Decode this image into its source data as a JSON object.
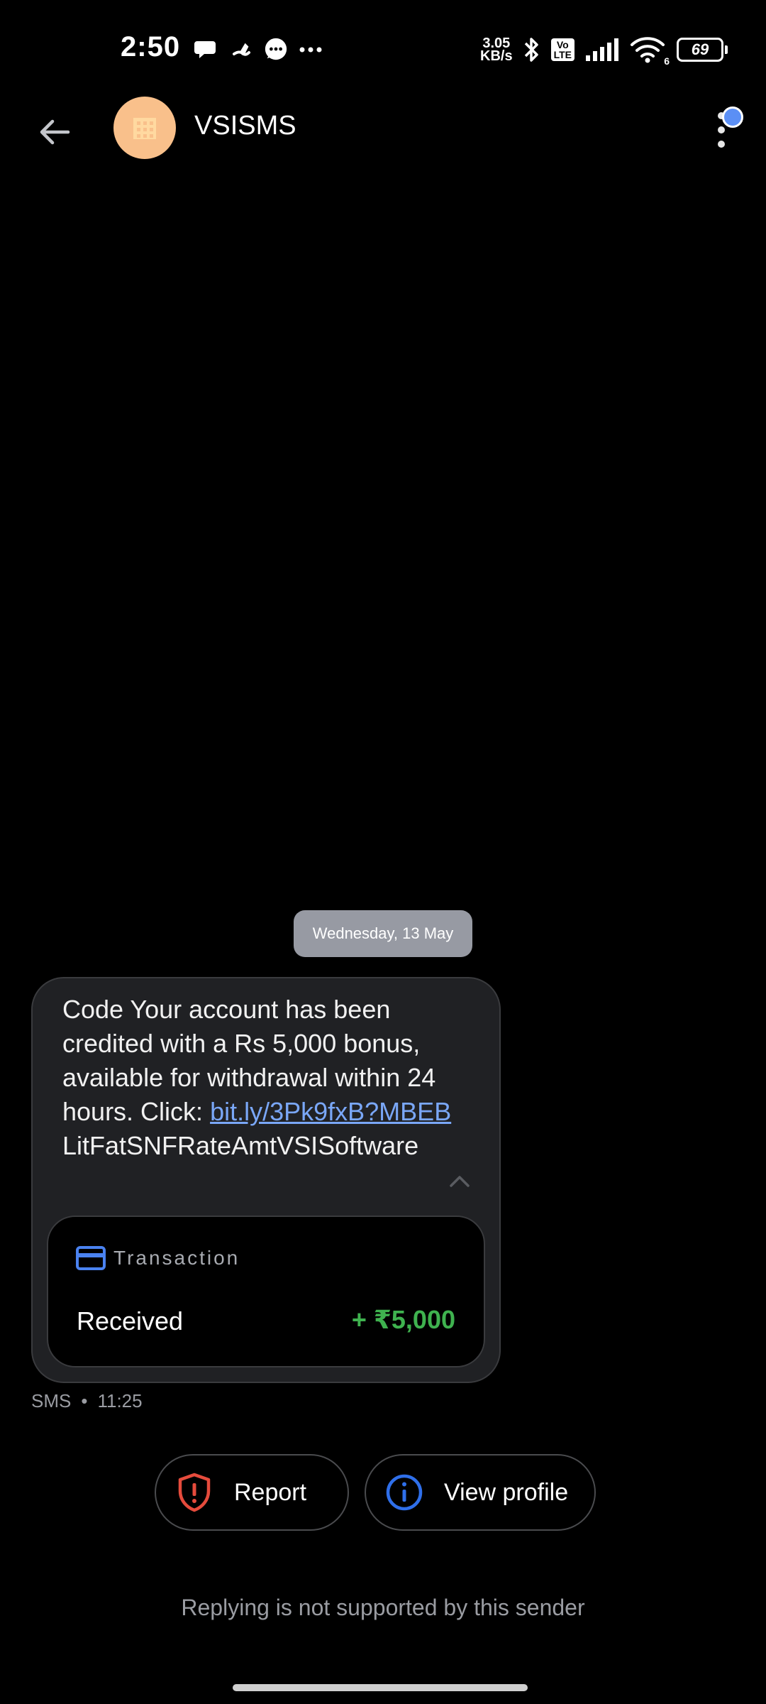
{
  "status_bar": {
    "time": "2:50",
    "net_speed_value": "3.05",
    "net_speed_unit": "KB/s",
    "volte_top": "Vo",
    "volte_bottom": "LTE",
    "wifi_badge": "6",
    "battery": "69",
    "notification_icons": [
      "chat-bubble-icon",
      "app-notification-icon",
      "messenger-icon",
      "more-notifications-icon"
    ]
  },
  "header": {
    "sender_name": "VSISMS",
    "avatar_color": "#f9c08b",
    "avatar_icon": "building-icon",
    "menu_badge_color": "#5b8ff5"
  },
  "conversation": {
    "date_chip": "Wednesday, 13 May",
    "message": {
      "text_before_link": "Code Your account has been credited with a Rs 5,000 bonus, available for withdrawal within 24 hours. Click: ",
      "link": "bit.ly/3Pk9fxB?MBEB",
      "text_after_link": "LitFatSNFRateAmtVSISoftware",
      "transaction": {
        "label": "Transaction",
        "type": "Received",
        "amount": "+ ₹5,000",
        "amount_color": "#3fb24f"
      },
      "channel": "SMS",
      "separator": "•",
      "time": "11:25"
    }
  },
  "actions": {
    "report_label": "Report",
    "view_profile_label": "View profile"
  },
  "footer": {
    "reply_note": "Replying is not supported by this sender"
  }
}
